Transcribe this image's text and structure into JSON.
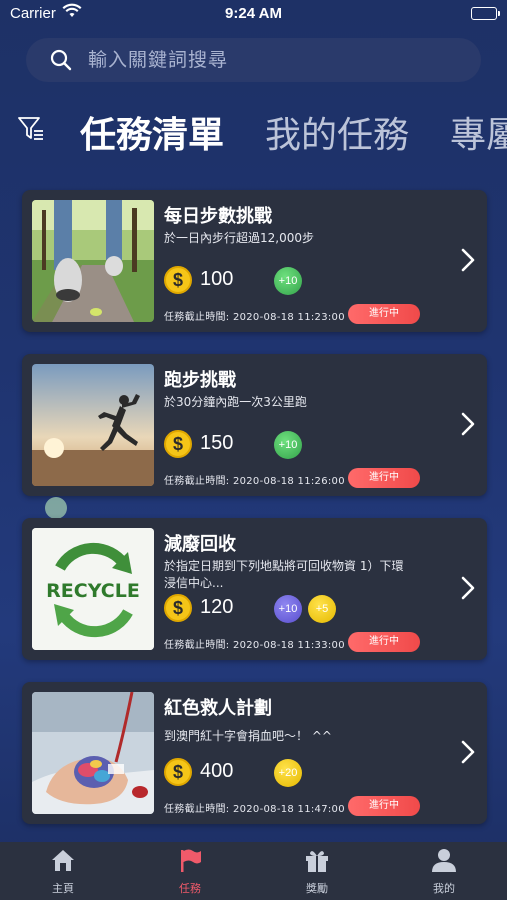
{
  "status_bar": {
    "carrier": "Carrier",
    "time": "9:24 AM"
  },
  "search": {
    "placeholder": "輸入關鍵詞搜尋"
  },
  "tabs": [
    {
      "label": "任務清單",
      "active": true
    },
    {
      "label": "我的任務",
      "active": false
    },
    {
      "label": "專屬",
      "active": false
    }
  ],
  "tasks": [
    {
      "title": "每日步數挑戰",
      "description": "於一日內步行超過12,000步",
      "points": "100",
      "coin_symbol": "$",
      "bonuses": [
        {
          "label": "+10",
          "color": "green"
        }
      ],
      "deadline": "任務截止時間: 2020-08-18 11:23:00",
      "status": "進行中"
    },
    {
      "title": "跑步挑戰",
      "description": "於30分鐘內跑一次3公里跑",
      "points": "150",
      "coin_symbol": "$",
      "bonuses": [
        {
          "label": "+10",
          "color": "green"
        }
      ],
      "deadline": "任務截止時間: 2020-08-18 11:26:00",
      "status": "進行中"
    },
    {
      "title": "減廢回收",
      "description": "於指定日期到下列地點將可回收物資 1）下環浸信中心...",
      "points": "120",
      "coin_symbol": "$",
      "bonuses": [
        {
          "label": "+10",
          "color": "purple"
        },
        {
          "label": "+5",
          "color": "yellow"
        }
      ],
      "deadline": "任務截止時間: 2020-08-18 11:33:00",
      "status": "進行中",
      "image_text": "RECYCLE"
    },
    {
      "title": "紅色救人計劃",
      "description": "到澳門紅十字會捐血吧～！ ^^",
      "points": "400",
      "coin_symbol": "$",
      "bonuses": [
        {
          "label": "+20",
          "color": "yellow"
        }
      ],
      "deadline": "任務截止時間: 2020-08-18 11:47:00",
      "status": "進行中"
    }
  ],
  "nav": [
    {
      "label": "主頁",
      "icon": "home-icon",
      "active": false
    },
    {
      "label": "任務",
      "icon": "flag-icon",
      "active": true
    },
    {
      "label": "獎勵",
      "icon": "gift-icon",
      "active": false
    },
    {
      "label": "我的",
      "icon": "person-icon",
      "active": false
    }
  ],
  "colors": {
    "accent": "#f05a6a",
    "status_pill": "#f04a4a",
    "card_bg": "#2b3140",
    "coin": "#f5c518"
  }
}
